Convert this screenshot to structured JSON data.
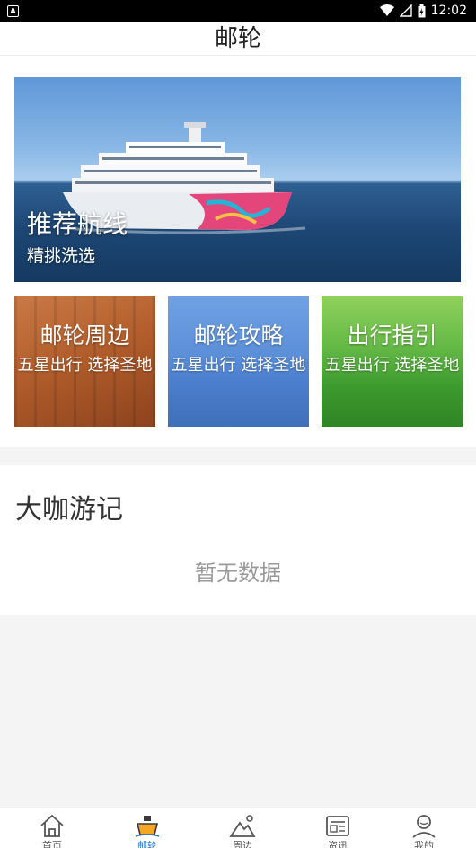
{
  "status_bar": {
    "app_badge": "A",
    "time": "12:02"
  },
  "header": {
    "title": "邮轮"
  },
  "banner": {
    "title": "推荐航线",
    "subtitle": "精挑洗选"
  },
  "cards": [
    {
      "title": "邮轮周边",
      "subtitle": "五星出行 选择圣地"
    },
    {
      "title": "邮轮攻略",
      "subtitle": "五星出行 选择圣地"
    },
    {
      "title": "出行指引",
      "subtitle": "五星出行 选择圣地"
    }
  ],
  "travel": {
    "title": "大咖游记",
    "empty_text": "暂无数据"
  },
  "tabs": [
    {
      "label": "首页",
      "icon": "home-icon"
    },
    {
      "label": "邮轮",
      "icon": "ship-icon",
      "active": true
    },
    {
      "label": "周边",
      "icon": "mountain-icon"
    },
    {
      "label": "资讯",
      "icon": "news-icon"
    },
    {
      "label": "我的",
      "icon": "user-icon"
    }
  ],
  "colors": {
    "active_tab": "#2a7ad4",
    "ship_icon": "#f5a623"
  }
}
